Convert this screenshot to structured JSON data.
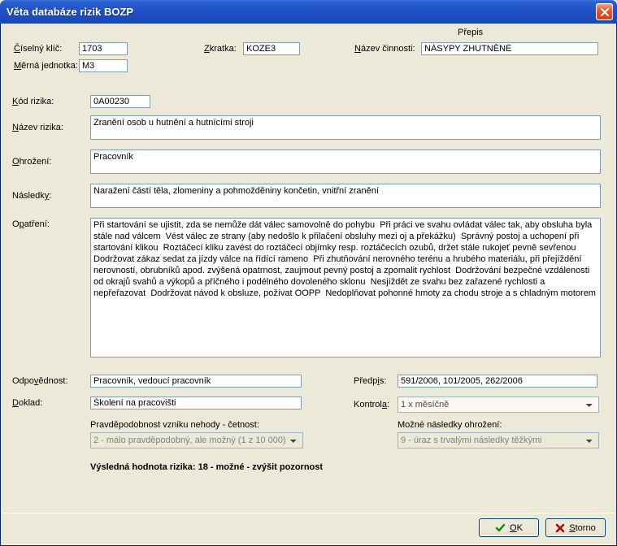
{
  "window": {
    "title": "Věta databáze rizik BOZP"
  },
  "header": {
    "prepis": "Přepis",
    "ciselny_klic_label": "Číselný klíč:",
    "ciselny_klic_value": "1703",
    "zkratka_label": "Zkratka:",
    "zkratka_value": "KOZE3",
    "nazev_cinnosti_label": "Název činnosti:",
    "nazev_cinnosti_value": "NÁSYPY ZHUTNĚNÉ",
    "merna_jednotka_label": "Měrná jednotka:",
    "merna_jednotka_value": "M3"
  },
  "form": {
    "kod_rizika_label": "Kód rizika:",
    "kod_rizika_value": "0A00230",
    "nazev_rizika_label": "Název rizika:",
    "nazev_rizika_value": "Zranění osob u hutnění a hutnícími stroji",
    "ohrozeni_label": "Ohrožení:",
    "ohrozeni_value": "Pracovník",
    "nasledky_label": "Následky:",
    "nasledky_value": "Naražení částí těla, zlomeniny a pohmožděniny končetin, vnitřní zranění",
    "opatreni_label": "Opatření:",
    "opatreni_value": "Při startování se ujistit, zda se nemůže dát válec samovolně do pohybu  Při práci ve svahu ovládat válec tak, aby obsluha byla stále nad válcem  Vést válec ze strany (aby nedošlo k přilačení obsluhy mezi oj a překážku)  Správný postoj a uchopení při startování klikou  Roztáčecí kliku zavést do roztáčecí objímky resp. roztáčecích ozubů, držet stále rukojeť pevně sevřenou   Dodržovat zákaz sedat za jízdy válce na řídící rameno  Při zhutňování nerovného terénu a hrubého materiálu, při přejíždění nerovností, obrubníků apod. zvýšená opatrnost, zaujmout pevný postoj a zpomalit rychlost  Dodržování bezpečné vzdálenosti od okrajů svahů a výkopů a příčného i podélného dovoleného sklonu  Nesjíždět ze svahu bez zařazené rychlosti a nepřeřazovat  Dodržovat návod k obsluze, požívat OOPP  Nedoplňovat pohonné hmoty za chodu stroje a s chladným motorem",
    "odpovednost_label": "Odpovědnost:",
    "odpovednost_value": "Pracovník, vedoucí pracovník",
    "predpis_label": "Předpis:",
    "predpis_value": "591/2006, 101/2005, 262/2006",
    "doklad_label": "Doklad:",
    "doklad_value": "Školení na pracovišti",
    "kontrola_label": "Kontrola:",
    "kontrola_value": "1 x měsíčně",
    "pravdepodobnost_label": "Pravděpodobnost vzniku nehody - četnost:",
    "pravdepodobnost_value": "2 - málo pravděpodobný, ale možný (1 z 10 000)",
    "mozne_nasledky_label": "Možné následky ohrožení:",
    "mozne_nasledky_value": "9 - úraz s trvalými následky těžkými",
    "vysledna_label": "Výsledná hodnota rizika:   18 - možné - zvýšit pozornost"
  },
  "buttons": {
    "ok": "OK",
    "storno": "Storno"
  }
}
